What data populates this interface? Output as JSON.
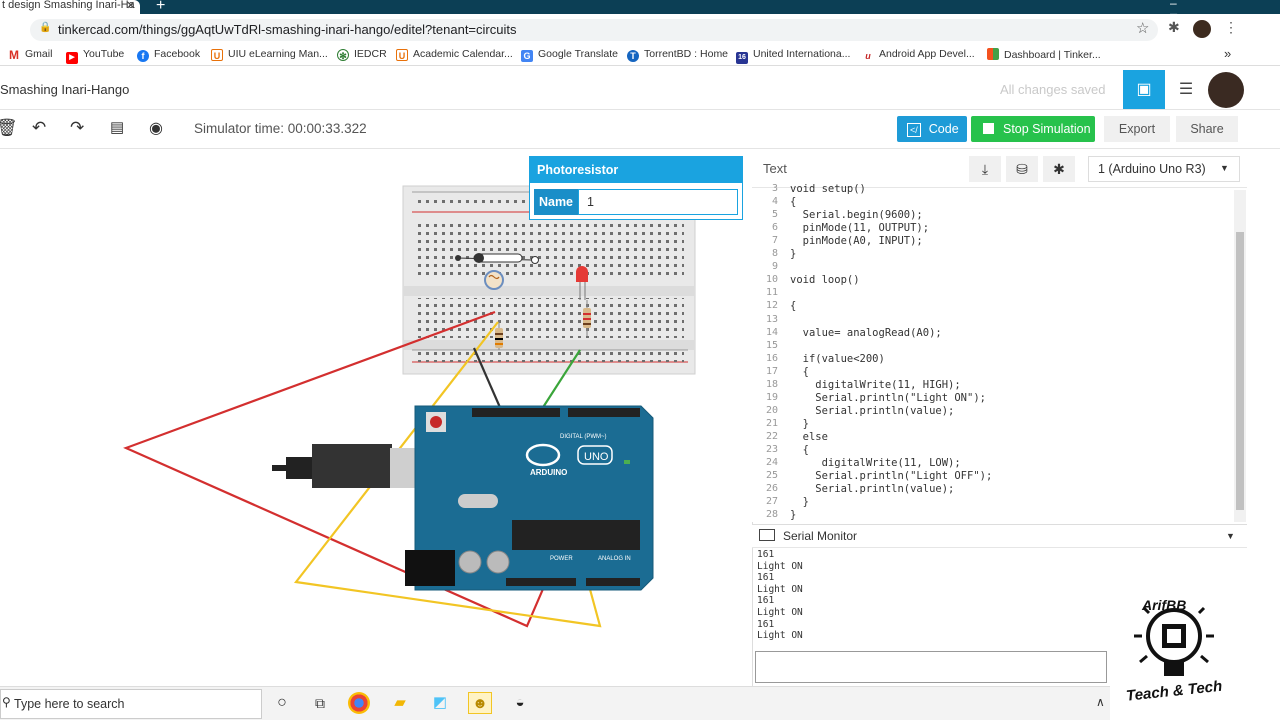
{
  "browser": {
    "tab_title": "t design Smashing Inari-Ha",
    "url": "tinkercad.com/things/ggAqtUwTdRl-smashing-inari-hango/editel?tenant=circuits",
    "bookmarks": [
      {
        "label": "Gmail",
        "icon": "gmail-icon",
        "color": "#d93025"
      },
      {
        "label": "YouTube",
        "icon": "youtube-icon",
        "color": "#ff0000"
      },
      {
        "label": "Facebook",
        "icon": "facebook-icon",
        "color": "#1877f2"
      },
      {
        "label": "UIU eLearning Man...",
        "icon": "uiu-icon",
        "color": "#e8710a"
      },
      {
        "label": "IEDCR",
        "icon": "iedcr-icon",
        "color": "#2e7d32"
      },
      {
        "label": "Academic Calendar...",
        "icon": "uiu-icon",
        "color": "#e8710a"
      },
      {
        "label": "Google Translate",
        "icon": "translate-icon",
        "color": "#4285f4"
      },
      {
        "label": "TorrentBD : Home",
        "icon": "torrentbd-icon",
        "color": "#1565c0"
      },
      {
        "label": "United Internationa...",
        "icon": "united-icon",
        "color": "#283593"
      },
      {
        "label": "Android App Devel...",
        "icon": "android-icon",
        "color": "#c62828"
      },
      {
        "label": "Dashboard | Tinker...",
        "icon": "tinkercad-icon",
        "color": "#f4511e"
      }
    ],
    "bookmarks_more": "»"
  },
  "header": {
    "project_title": "Smashing Inari-Hango",
    "save_status": "All changes saved"
  },
  "toolbar": {
    "sim_time": "Simulator time: 00:00:33.322",
    "code_label": "Code",
    "stop_label": "Stop Simulation",
    "export_label": "Export",
    "share_label": "Share"
  },
  "inspector": {
    "title": "Photoresistor",
    "name_label": "Name",
    "name_value": "1"
  },
  "code_panel": {
    "mode": "Text",
    "board": "1 (Arduino Uno R3)",
    "lines": [
      {
        "n": "3",
        "t": "void setup()"
      },
      {
        "n": "4",
        "t": "{"
      },
      {
        "n": "5",
        "t": "  Serial.begin(9600);"
      },
      {
        "n": "6",
        "t": "  pinMode(11, OUTPUT);"
      },
      {
        "n": "7",
        "t": "  pinMode(A0, INPUT);"
      },
      {
        "n": "8",
        "t": "}"
      },
      {
        "n": "9",
        "t": ""
      },
      {
        "n": "10",
        "t": "void loop()"
      },
      {
        "n": "11",
        "t": ""
      },
      {
        "n": "12",
        "t": "{"
      },
      {
        "n": "13",
        "t": ""
      },
      {
        "n": "14",
        "t": "  value= analogRead(A0);"
      },
      {
        "n": "15",
        "t": ""
      },
      {
        "n": "16",
        "t": "  if(value<200)"
      },
      {
        "n": "17",
        "t": "  {"
      },
      {
        "n": "18",
        "t": "    digitalWrite(11, HIGH);"
      },
      {
        "n": "19",
        "t": "    Serial.println(\"Light ON\");"
      },
      {
        "n": "20",
        "t": "    Serial.println(value);"
      },
      {
        "n": "21",
        "t": "  }"
      },
      {
        "n": "22",
        "t": "  else"
      },
      {
        "n": "23",
        "t": "  {"
      },
      {
        "n": "24",
        "t": "     digitalWrite(11, LOW);"
      },
      {
        "n": "25",
        "t": "    Serial.println(\"Light OFF\");"
      },
      {
        "n": "26",
        "t": "    Serial.println(value);"
      },
      {
        "n": "27",
        "t": "  }"
      },
      {
        "n": "28",
        "t": "}"
      }
    ],
    "serial_title": "Serial Monitor",
    "serial_lines": [
      "161",
      "Light ON",
      "161",
      "Light ON",
      "161",
      "Light ON",
      "161",
      "Light ON"
    ]
  },
  "taskbar": {
    "search_placeholder": "Type here to search"
  },
  "logo": {
    "top_text": "ArifBB",
    "bottom_text": "Teach & Tech"
  },
  "colors": {
    "accent": "#1aa3e0",
    "stop_green": "#27c24c",
    "arduino_blue": "#1b6c93",
    "wire_red": "#d32f2f",
    "wire_yellow": "#f2c524",
    "wire_green": "#3aa53a"
  }
}
